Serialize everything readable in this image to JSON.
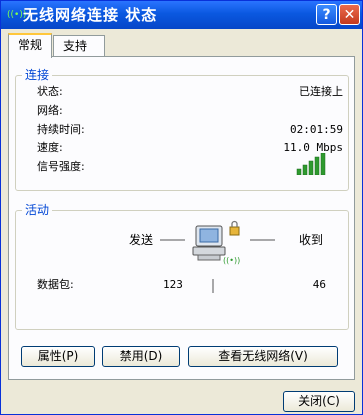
{
  "window": {
    "title": "无线网络连接 状态",
    "app_icon_glyph": "((•))",
    "help_label": "?",
    "close_label": "✕"
  },
  "tabs": [
    {
      "label": "常规"
    },
    {
      "label": "支持"
    }
  ],
  "connection": {
    "legend": "连接",
    "status_label": "状态:",
    "status_value": "已连接上",
    "network_label": "网络:",
    "network_value": "",
    "duration_label": "持续时间:",
    "duration_value": "02:01:59",
    "speed_label": "速度:",
    "speed_value": "11.0 Mbps",
    "signal_label": "信号强度:",
    "signal_bars": 5,
    "signal_color": "#2e9a2e"
  },
  "activity": {
    "legend": "活动",
    "sent_label": "发送",
    "received_label": "收到",
    "packets_label": "数据包:",
    "packets_sent": "123",
    "packets_received": "46",
    "wireless_glyph": "((•))"
  },
  "buttons": {
    "properties": "属性(P)",
    "disable": "禁用(D)",
    "view_networks": "查看无线网络(V)",
    "close": "关闭(C)"
  }
}
